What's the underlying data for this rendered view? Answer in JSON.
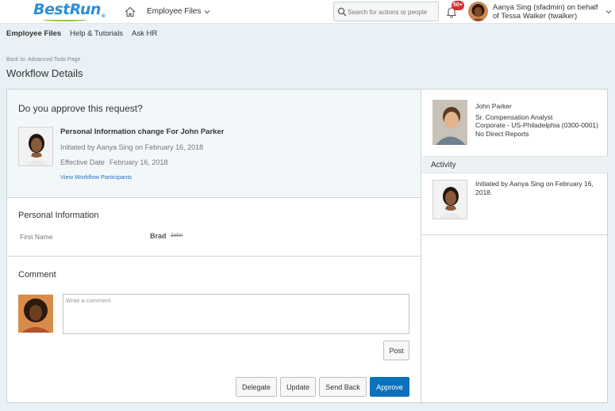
{
  "header": {
    "logo": "BestRun",
    "module_menu": "Employee Files",
    "search_placeholder": "Search for actions or people",
    "notification_badge": "50+",
    "user_name": "Aanya Sing (sfadmin) on behalf of Tessa Walker (twalker)"
  },
  "subnav": {
    "items": [
      "Employee Files",
      "Help & Tutorials",
      "Ask HR"
    ]
  },
  "page": {
    "back_link": "Back to: Advanced Todo Page",
    "title": "Workflow Details"
  },
  "request": {
    "question": "Do you approve this request?",
    "title": "Personal Information change For John Parker",
    "initiated": "Initiated by Aanya Sing on February 16, 2018",
    "effective_label": "Effective Date",
    "effective_value": "February 16, 2018",
    "participants_link": "View Workflow Participants"
  },
  "personal_info": {
    "title": "Personal Information",
    "field_label": "First Name",
    "new_value": "Brad",
    "old_value": "John"
  },
  "comment": {
    "title": "Comment",
    "placeholder": "Write a comment",
    "post_label": "Post"
  },
  "actions": {
    "delegate": "Delegate",
    "update": "Update",
    "send_back": "Send Back",
    "approve": "Approve"
  },
  "employee": {
    "name": "John Parker",
    "title": "Sr. Compensation Analyst",
    "location": "Corporate - US-Philadelphia (0300-0001)",
    "reports": "No Direct Reports"
  },
  "activity": {
    "title": "Activity",
    "entry": "Initiated by Aanya Sing on February 16, 2018."
  },
  "colors": {
    "accent": "#0a72bb",
    "brand": "#2e8fd6",
    "badge": "#d92d2d",
    "link": "#2a6ebb"
  }
}
